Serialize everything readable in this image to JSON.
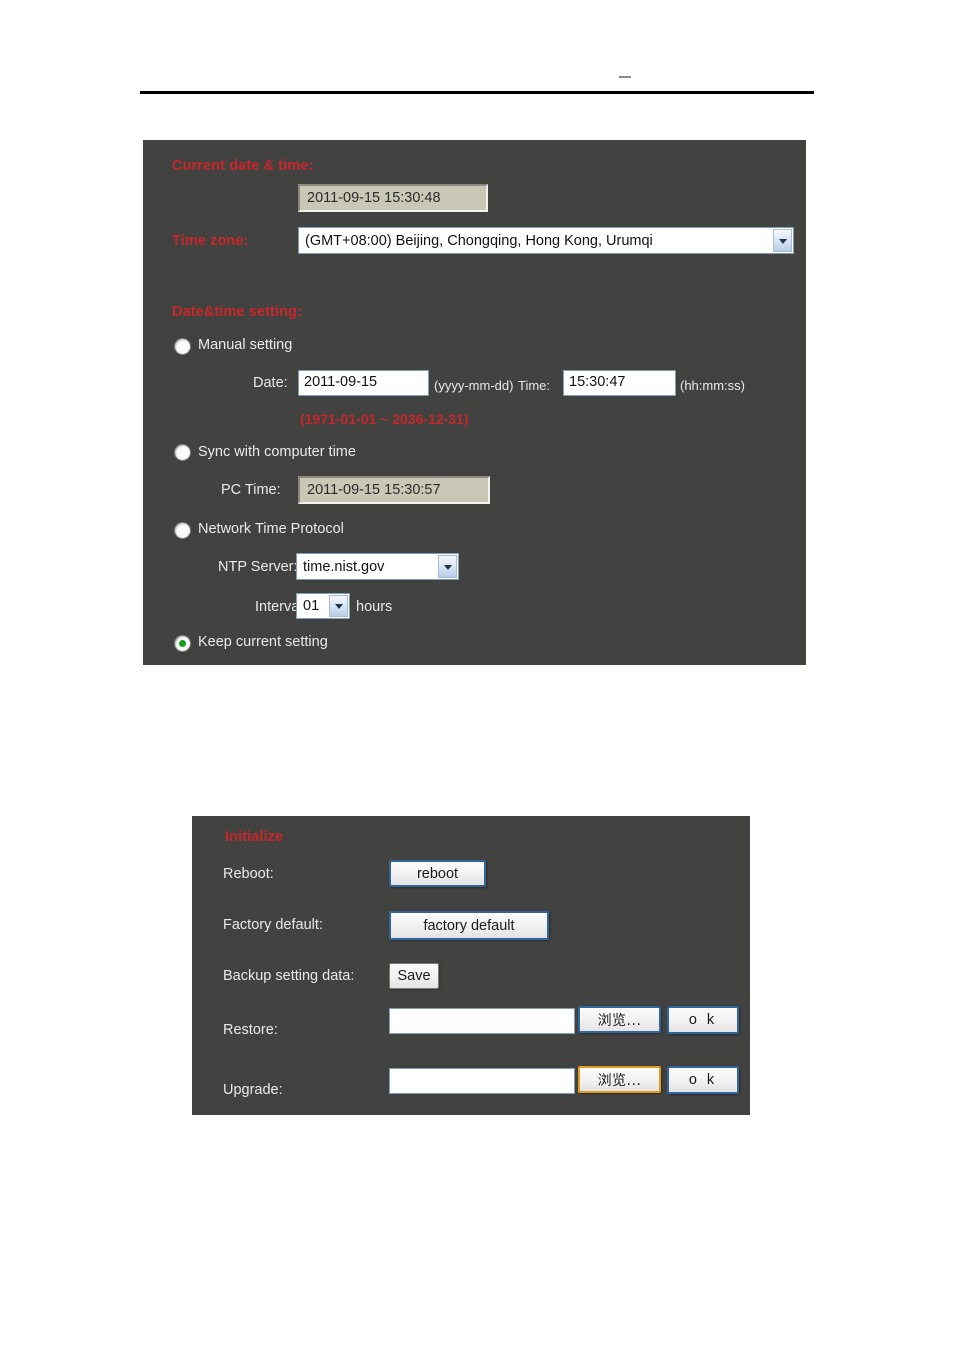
{
  "header": {
    "mark": "—"
  },
  "datetime_panel": {
    "current_label": "Current date & time:",
    "current_value": "2011-09-15 15:30:48",
    "timezone_label": "Time zone:",
    "timezone_value": "(GMT+08:00) Beijing, Chongqing, Hong Kong, Urumqi",
    "setting_label": "Date&time setting:",
    "manual": {
      "radio_label": "Manual setting",
      "selected": false,
      "date_label": "Date:",
      "date_value": "2011-09-15",
      "date_hint": "(yyyy-mm-dd)",
      "time_label": "Time:",
      "time_value": "15:30:47",
      "time_hint": "(hh:mm:ss)",
      "range_note": "(1971-01-01 ~ 2036-12-31)"
    },
    "sync": {
      "radio_label": "Sync with computer time",
      "selected": false,
      "pc_time_label": "PC Time:",
      "pc_time_value": "2011-09-15 15:30:57"
    },
    "ntp": {
      "radio_label": "Network Time Protocol",
      "selected": false,
      "server_label": "NTP Server:",
      "server_value": "time.nist.gov",
      "interval_label": "Interval:",
      "interval_value": "01",
      "interval_unit": "hours"
    },
    "keep": {
      "radio_label": "Keep current setting",
      "selected": true
    }
  },
  "initialize_panel": {
    "title": "Initialize",
    "rows": [
      {
        "label": "Reboot:",
        "button": "reboot"
      },
      {
        "label": "Factory default:",
        "button": "factory default"
      },
      {
        "label": "Backup setting data:",
        "button": "Save"
      },
      {
        "label": "Restore:",
        "field": "",
        "browse": "浏览...",
        "ok": "o k"
      },
      {
        "label": "Upgrade:",
        "field": "",
        "browse": "浏览...",
        "ok": "o k"
      }
    ]
  },
  "colors": {
    "panel_bg": "#424241",
    "label_red": "#c9272b",
    "label_light": "#e9e9e9",
    "radio_selected": "#16a01a",
    "button_border": "#31659c",
    "focus_border": "#e09b21",
    "readonly_bg": "#c9c7b6"
  }
}
